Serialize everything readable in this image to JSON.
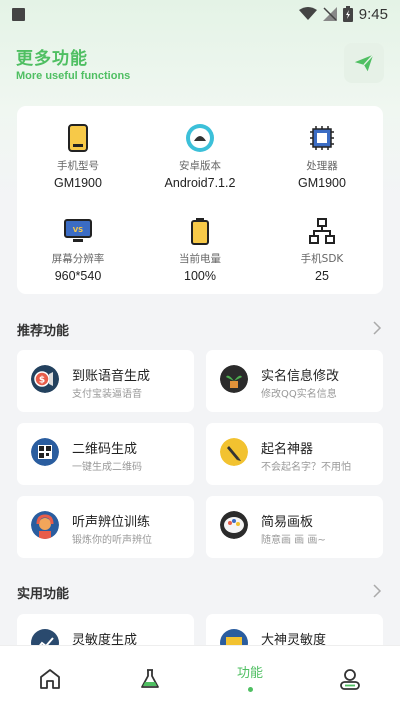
{
  "status_bar": {
    "time": "9:45"
  },
  "header": {
    "title": "更多功能",
    "subtitle": "More useful functions"
  },
  "device_info": [
    {
      "label": "手机型号",
      "value": "GM1900",
      "icon": "phone-icon"
    },
    {
      "label": "安卓版本",
      "value": "Android7.1.2",
      "icon": "android-icon"
    },
    {
      "label": "处理器",
      "value": "GM1900",
      "icon": "cpu-icon"
    },
    {
      "label": "屏幕分辨率",
      "value": "960*540",
      "icon": "monitor-icon"
    },
    {
      "label": "当前电量",
      "value": "100%",
      "icon": "battery-icon"
    },
    {
      "label": "手机SDK",
      "value": "25",
      "icon": "network-icon"
    }
  ],
  "sections": {
    "recommended": "推荐功能",
    "practical": "实用功能"
  },
  "recommended_features": [
    {
      "name": "到账语音生成",
      "desc": "支付宝装逼语音",
      "icon": "coin-speaker-icon"
    },
    {
      "name": "实名信息修改",
      "desc": "修改QQ实名信息",
      "icon": "plant-icon"
    },
    {
      "name": "二维码生成",
      "desc": "一键生成二维码",
      "icon": "qrcode-icon"
    },
    {
      "name": "起名神器",
      "desc": "不会起名字？不用怕",
      "icon": "pencil-icon"
    },
    {
      "name": "听声辨位训练",
      "desc": "锻炼你的听声辨位",
      "icon": "headset-person-icon"
    },
    {
      "name": "简易画板",
      "desc": "随意画 画 画~",
      "icon": "palette-icon"
    }
  ],
  "practical_features": [
    {
      "name": "灵敏度生成",
      "icon": "chart-icon"
    },
    {
      "name": "大神灵敏度",
      "icon": "folder-icon"
    }
  ],
  "bottom_nav": {
    "active_label": "功能"
  },
  "colors": {
    "accent": "#4fbf62",
    "background": "#f3f4f6"
  }
}
